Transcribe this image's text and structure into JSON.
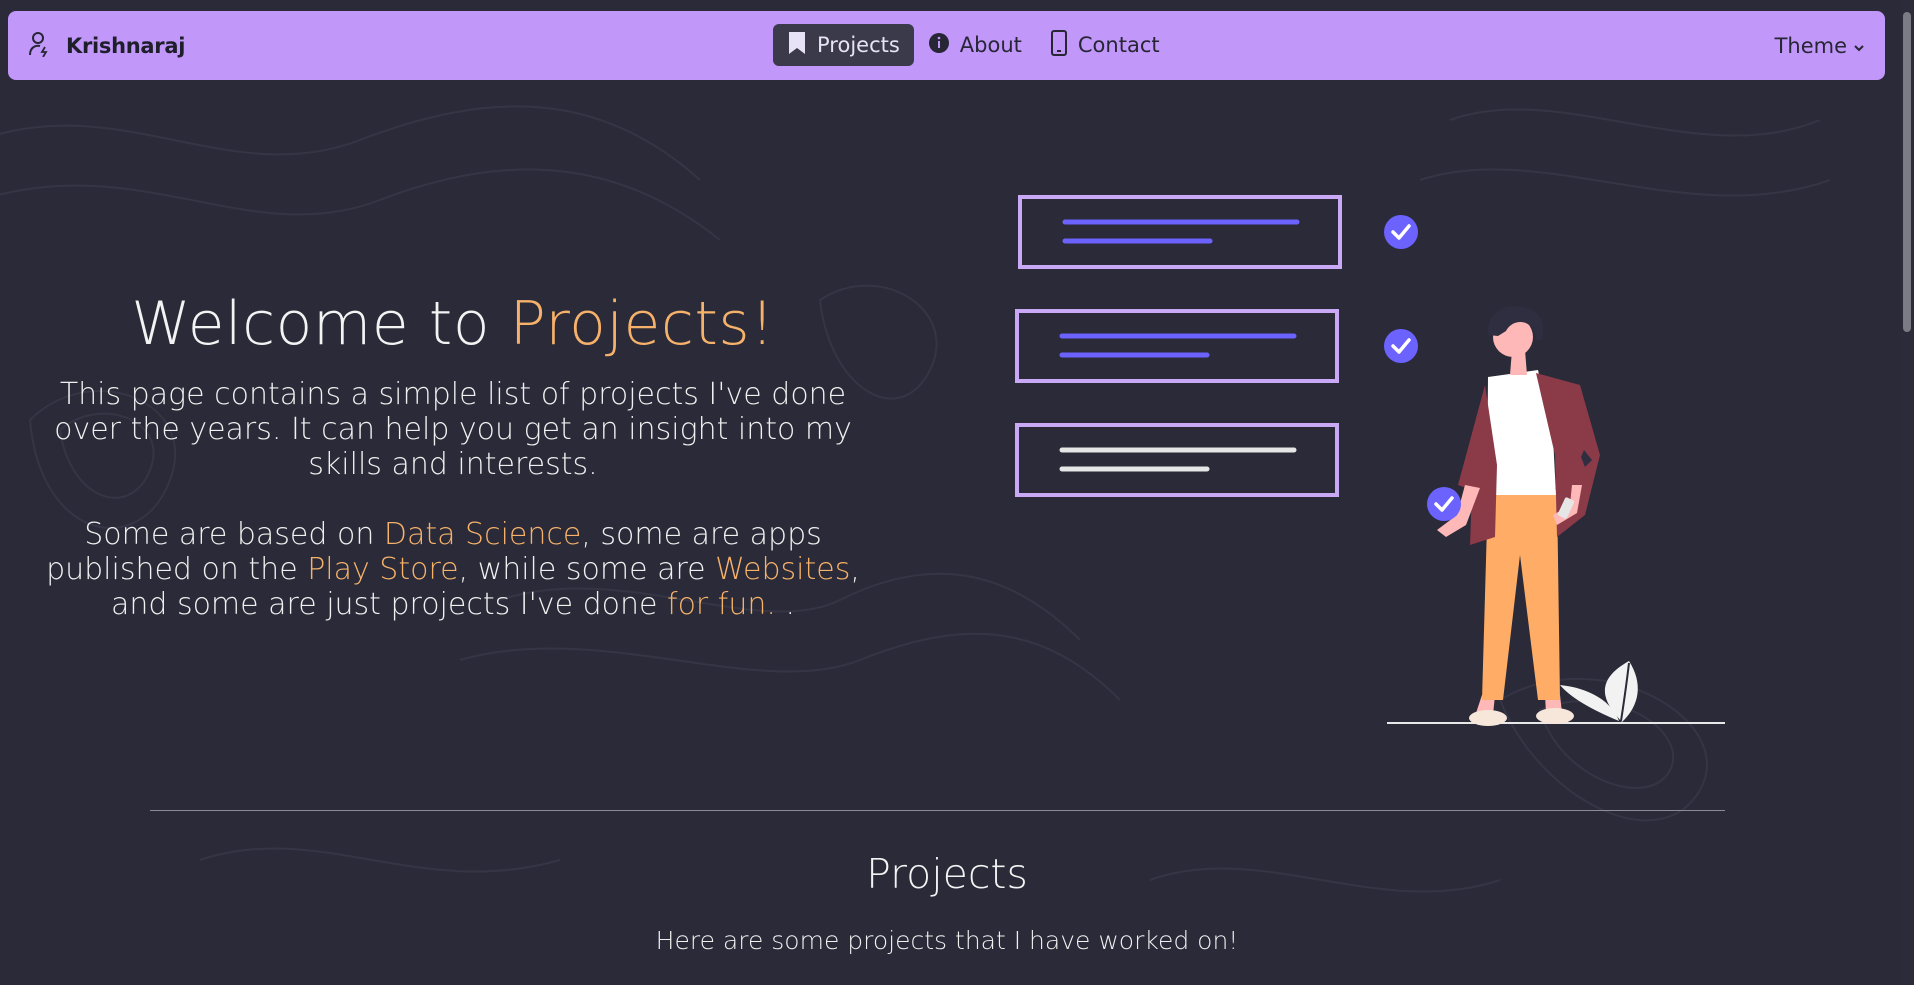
{
  "navbar": {
    "brand": "Krishnaraj",
    "links": [
      {
        "label": "Projects",
        "icon": "bookmark-icon",
        "active": true
      },
      {
        "label": "About",
        "icon": "info-icon"
      },
      {
        "label": "Contact",
        "icon": "phone-icon"
      }
    ],
    "theme_label": "Theme"
  },
  "hero": {
    "title_prefix": "Welcome to ",
    "title_accent": "Projects!",
    "para1": "This page contains a simple list of projects I've done over the years. It can help you get an insight into my skills and interests.",
    "para2": {
      "t1": "Some are based on ",
      "l1": "Data Science",
      "t2": ", some are apps published on the ",
      "l2": "Play Store",
      "t3": ", while some are ",
      "l3": "Websites",
      "t4": ", and some are just projects I've done ",
      "l4": "for fun.",
      "t5": " ."
    }
  },
  "section": {
    "title": "Projects",
    "subtitle": "Here are some projects that I have worked on!"
  },
  "colors": {
    "background": "#2a2a38",
    "navbar": "#c197fa",
    "accent": "#f6b26b",
    "check": "#6c63ff"
  }
}
